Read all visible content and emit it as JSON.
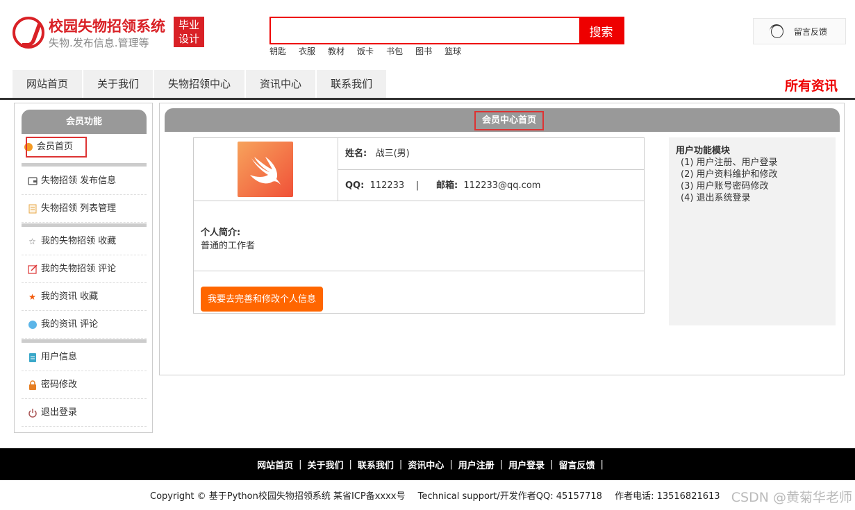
{
  "header": {
    "site_title": "校园失物招领系统",
    "site_subtitle": "失物.发布信息.管理等",
    "badge_line1": "毕业",
    "badge_line2": "设计",
    "search_placeholder": "",
    "search_button": "搜索",
    "hot_tags": [
      "钥匙",
      "衣服",
      "教材",
      "饭卡",
      "书包",
      "图书",
      "篮球"
    ],
    "feedback_label": "留言反馈"
  },
  "nav": {
    "items": [
      "网站首页",
      "关于我们",
      "失物招领中心",
      "资讯中心",
      "联系我们"
    ],
    "right_label": "所有资讯"
  },
  "sidebar": {
    "title": "会员功能",
    "items": [
      {
        "label": "会员首页"
      },
      {
        "label": "失物招领 发布信息"
      },
      {
        "label": "失物招领 列表管理"
      },
      {
        "label": "我的失物招领 收藏"
      },
      {
        "label": "我的失物招领 评论"
      },
      {
        "label": "我的资讯 收藏"
      },
      {
        "label": "我的资讯 评论"
      },
      {
        "label": "用户信息"
      },
      {
        "label": "密码修改"
      },
      {
        "label": "退出登录"
      }
    ]
  },
  "main": {
    "title": "会员中心首页",
    "name_label": "姓名:",
    "name_value": "战三(男)",
    "qq_label": "QQ:",
    "qq_value": "112233",
    "divider": "|",
    "email_label": "邮箱:",
    "email_value": "112233@qq.com",
    "intro_label": "个人简介:",
    "intro_value": "普通的工作者",
    "edit_button": "我要去完善和修改个人信息"
  },
  "functions": {
    "title": "用户功能模块",
    "items": [
      "(1) 用户注册、用户登录",
      "(2) 用户资料维护和修改",
      "(3) 用户账号密码修改",
      "(4) 退出系统登录"
    ]
  },
  "footer": {
    "links": [
      "网站首页",
      "关于我们",
      "联系我们",
      "资讯中心",
      "用户注册",
      "用户登录",
      "留言反馈"
    ],
    "separator": "|",
    "copyright": "Copyright © 基于Python校园失物招领系统 某省ICP备xxxx号",
    "support": "Technical support/开发作者QQ: 45157718",
    "phone": "作者电话: 13516821613",
    "watermark": "CSDN @黄菊华老师"
  },
  "colors": {
    "accent_red": "#e00000",
    "button_orange": "#ff6600",
    "header_gray": "#999999"
  }
}
